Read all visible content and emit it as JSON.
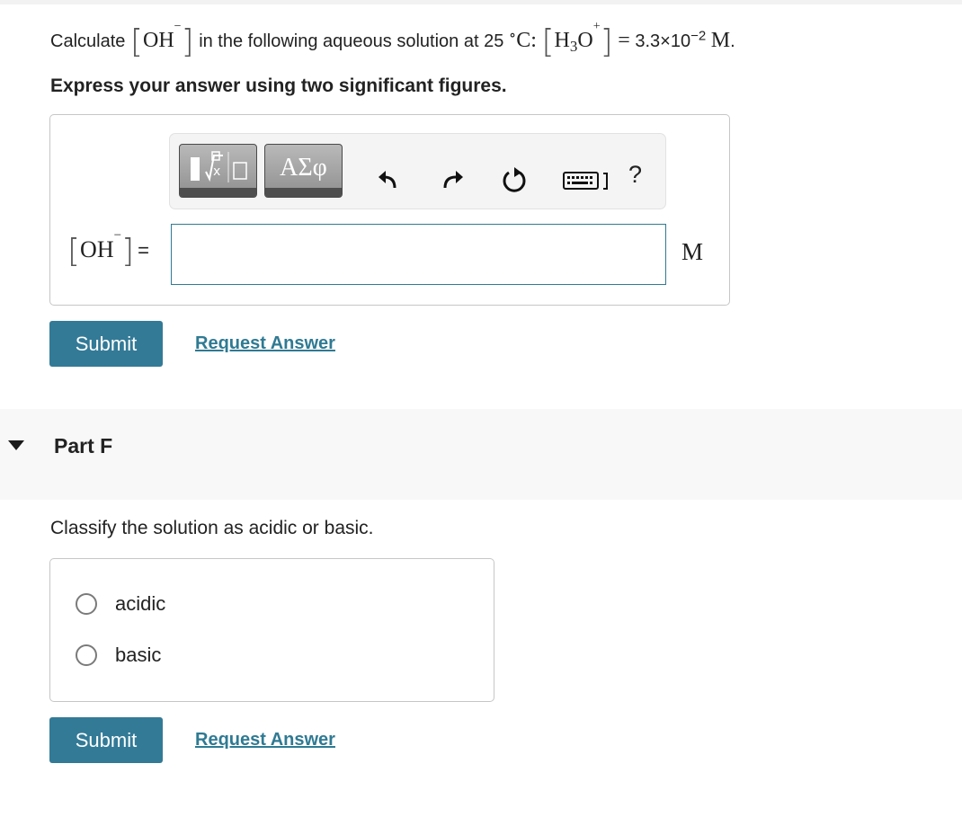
{
  "question": {
    "prefix": "Calculate",
    "target_species": "OH",
    "target_charge": "−",
    "middle_text": "in the following aqueous solution at 25",
    "degree": "∘",
    "temp_unit": "C:",
    "given_species_h": "H",
    "given_species_sub": "3",
    "given_species_o": "O",
    "given_charge": "+",
    "equals": "=",
    "given_value": "3.3×10",
    "given_exponent": "−2",
    "given_unit": "M",
    "period": "."
  },
  "instruction": "Express your answer using two significant figures.",
  "toolbar": {
    "templates_icon": "sqrt-template-icon",
    "symbols_label": "ΑΣφ",
    "undo_icon": "undo-icon",
    "redo_icon": "redo-icon",
    "reset_icon": "reset-icon",
    "keyboard_icon": "keyboard-icon",
    "help_label": "?"
  },
  "answer": {
    "lhs_species": "OH",
    "lhs_charge": "−",
    "equals": "=",
    "value": "",
    "unit": "M"
  },
  "actions_e": {
    "submit_label": "Submit",
    "request_label": "Request Answer"
  },
  "part_f": {
    "title": "Part F",
    "prompt": "Classify the solution as acidic or basic.",
    "options": [
      "acidic",
      "basic"
    ],
    "submit_label": "Submit",
    "request_label": "Request Answer"
  },
  "colors": {
    "accent": "#337a97",
    "link": "#2f7a93",
    "border": "#c6c6c6"
  }
}
